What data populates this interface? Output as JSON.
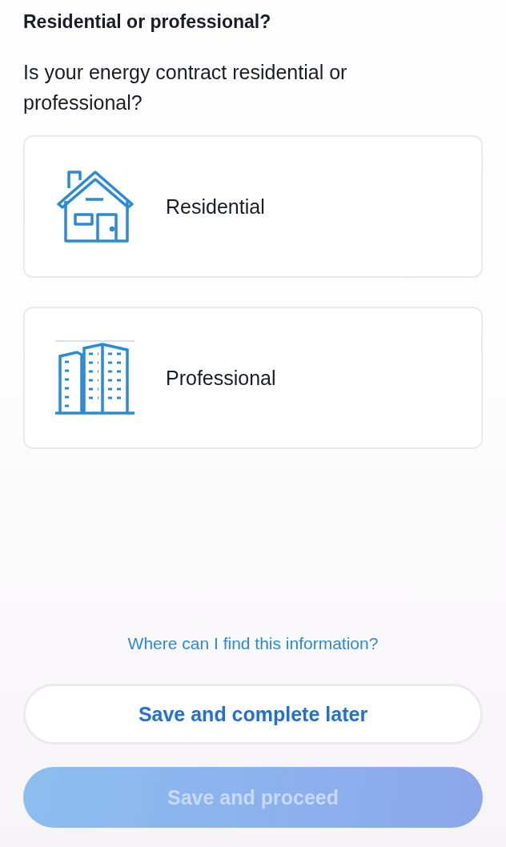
{
  "title": "Residential or professional?",
  "question": "Is your energy contract residential or professional?",
  "options": [
    {
      "kind": "house",
      "label": "Residential",
      "selected": false
    },
    {
      "kind": "building",
      "label": "Professional",
      "selected": false
    }
  ],
  "help_link": "Where can I find this information?",
  "buttons": [
    {
      "kind": "secondary",
      "label": "Save and complete later",
      "disabled": false
    },
    {
      "kind": "primary",
      "label": "Save and proceed",
      "disabled": true
    }
  ]
}
